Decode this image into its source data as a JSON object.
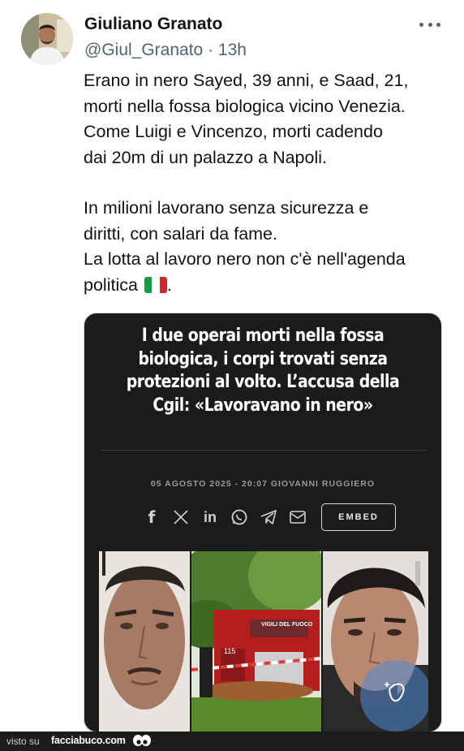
{
  "author": {
    "name": "Giuliano Granato",
    "handle": "@Giul_Granato",
    "time_separator": " · ",
    "time": "13h"
  },
  "tweet": {
    "lines": [
      "Erano in nero Sayed, 39 anni, e Saad, 21,",
      "morti nella fossa biologica vicino Venezia.",
      "Come Luigi  e Vincenzo, morti cadendo",
      "dai 20m di un palazzo a Napoli.",
      "In milioni lavorano senza sicurezza e",
      "diritti, con salari da fame.",
      "La lotta al lavoro nero non c'è nell'agenda",
      "politica"
    ],
    "after_flag": ".",
    "flag_colors": [
      "#1a9b49",
      "#ffffff",
      "#d6262b"
    ]
  },
  "card": {
    "headline_lines": [
      "I due operai morti nella fossa",
      "biologica, i corpi trovati senza",
      "protezioni al volto. L’accusa della",
      "Cgil: «Lavoravano in nero»"
    ],
    "byline": "05 AGOSTO 2025 - 20:07 GIOVANNI RUGGIERO",
    "share_icons": [
      "facebook-icon",
      "x-icon",
      "linkedin-icon",
      "whatsapp-icon",
      "telegram-icon",
      "mail-icon"
    ],
    "share_labels": {
      "facebook": "f",
      "linkedin": "in"
    },
    "embed_label": "EMBED",
    "truck_text": "VIGILI DEL FUOCO",
    "truck_number": "115"
  },
  "footer": {
    "prefix": "visto su",
    "site": "facciabuco.com"
  }
}
